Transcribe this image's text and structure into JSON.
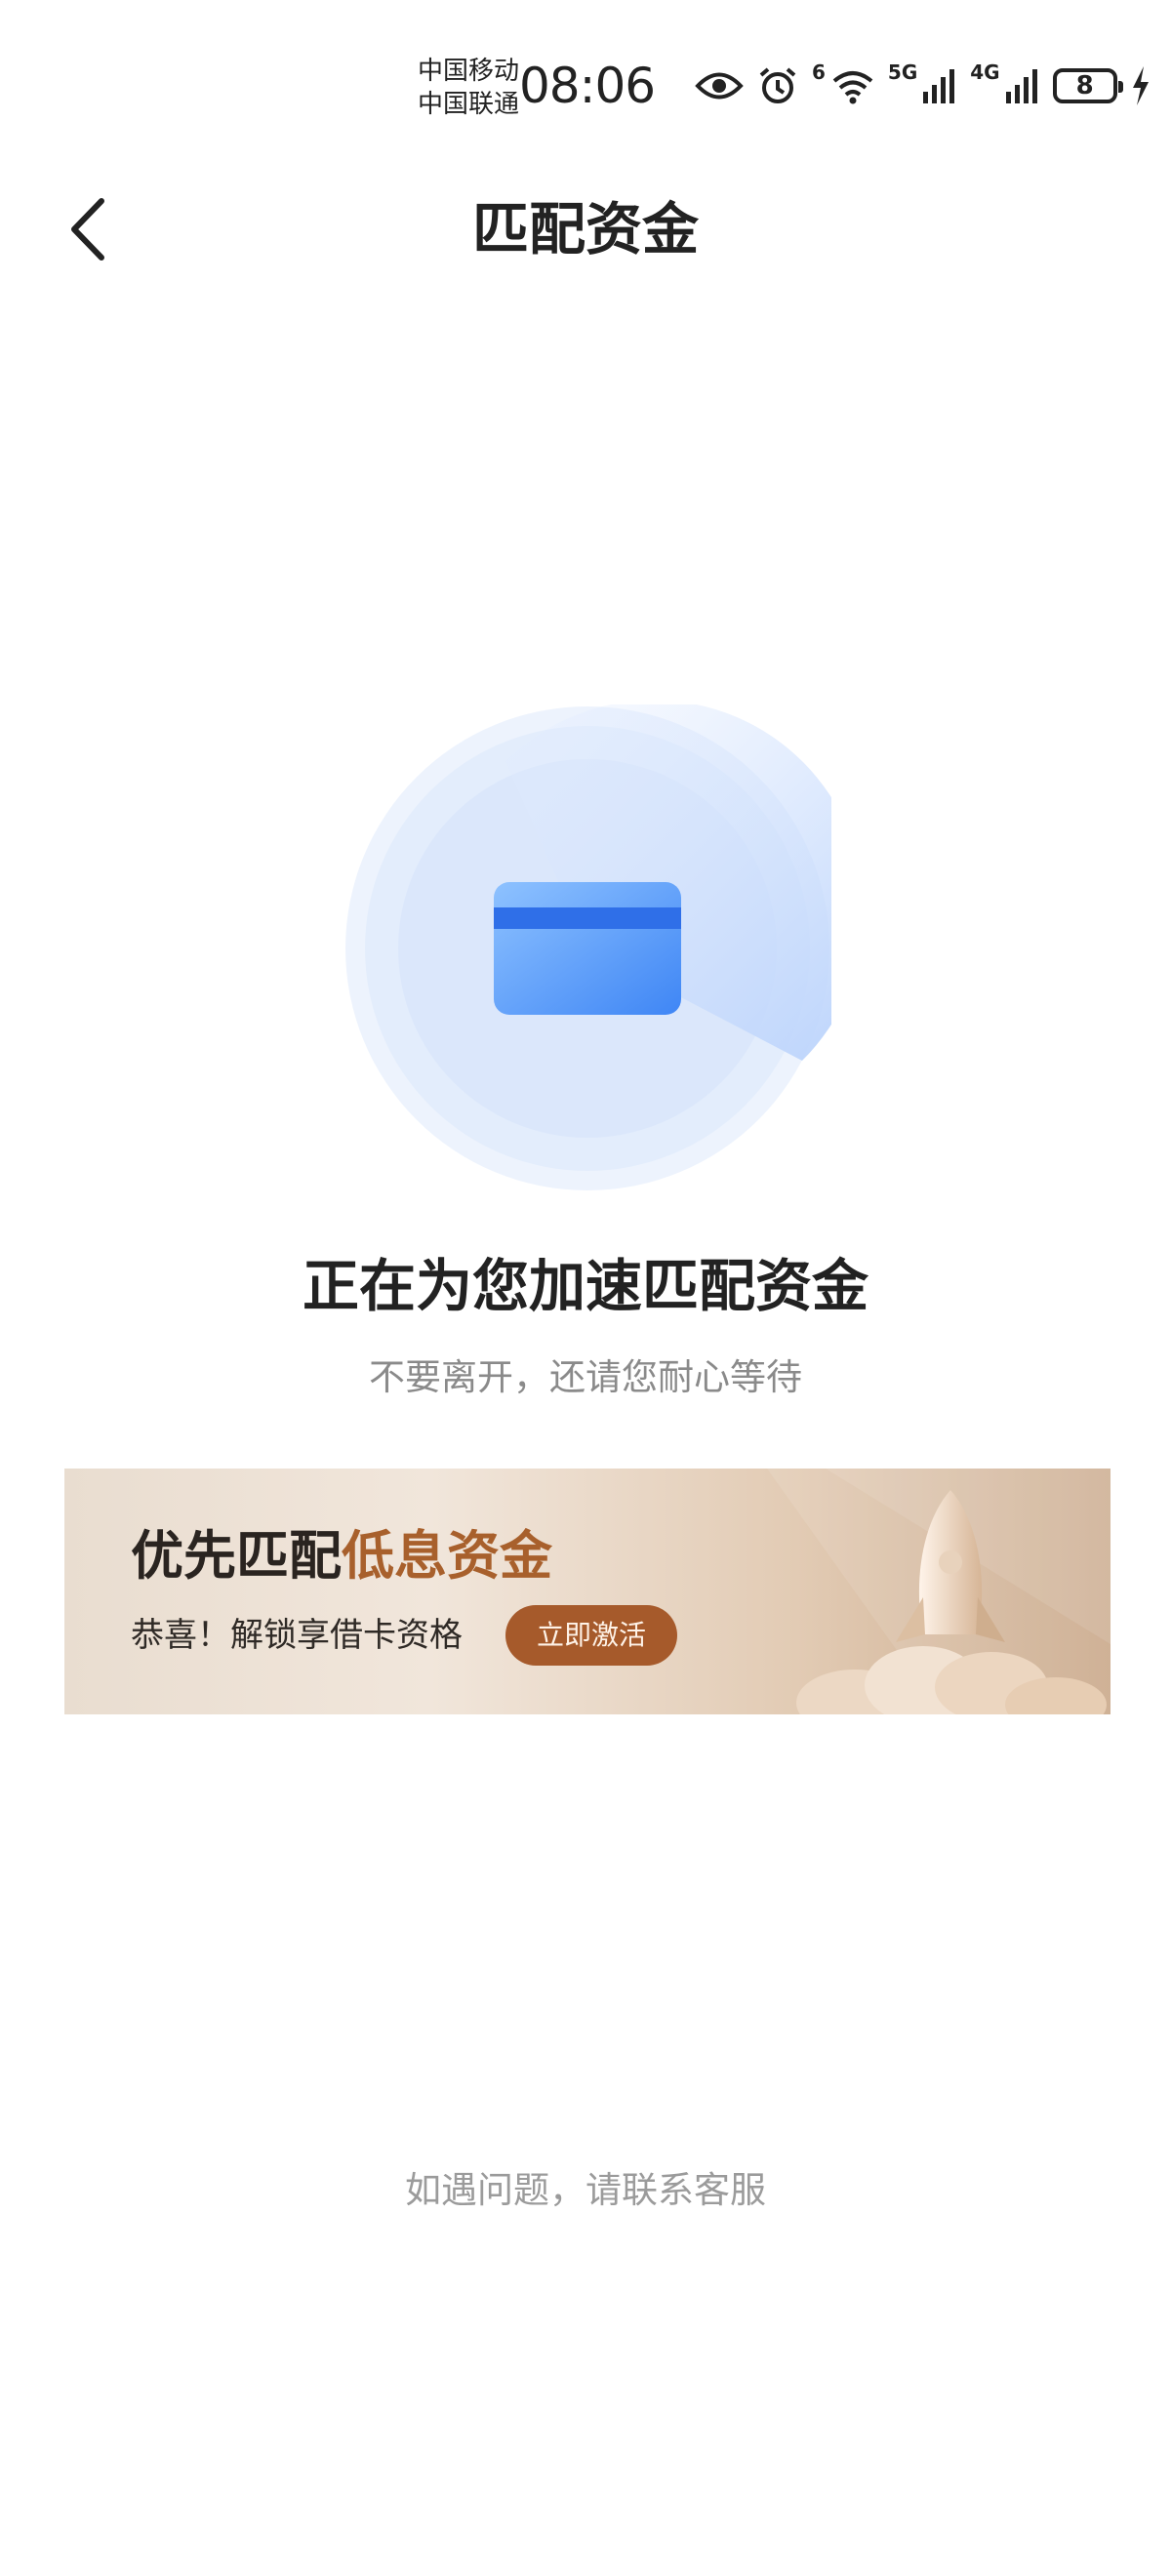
{
  "status_bar": {
    "carrier_1": "中国移动",
    "carrier_2": "中国联通",
    "time": "08:06",
    "wifi_label": "6",
    "network_1": "5G",
    "network_2": "4G",
    "battery_level": "8",
    "icons": [
      "eye-icon",
      "alarm-icon",
      "wifi-icon",
      "signal-icon",
      "signal-icon",
      "battery-icon",
      "charging-icon"
    ]
  },
  "nav": {
    "title": "匹配资金",
    "back_icon": "chevron-left-icon"
  },
  "loading": {
    "icon": "bank-card-icon",
    "title": "正在为您加速匹配资金",
    "subtitle": "不要离开，还请您耐心等待"
  },
  "banner": {
    "heading_plain": "优先匹配",
    "heading_highlight": "低息资金",
    "subtext": "恭喜！解锁享借卡资格",
    "cta_label": "立即激活",
    "image": "rocket-icon"
  },
  "footer": {
    "help_text": "如遇问题，请联系客服"
  },
  "colors": {
    "accent_blue": "#4a8cf7",
    "banner_accent": "#a65a2b",
    "text_primary": "#222222",
    "text_secondary": "#8a8a8a"
  }
}
